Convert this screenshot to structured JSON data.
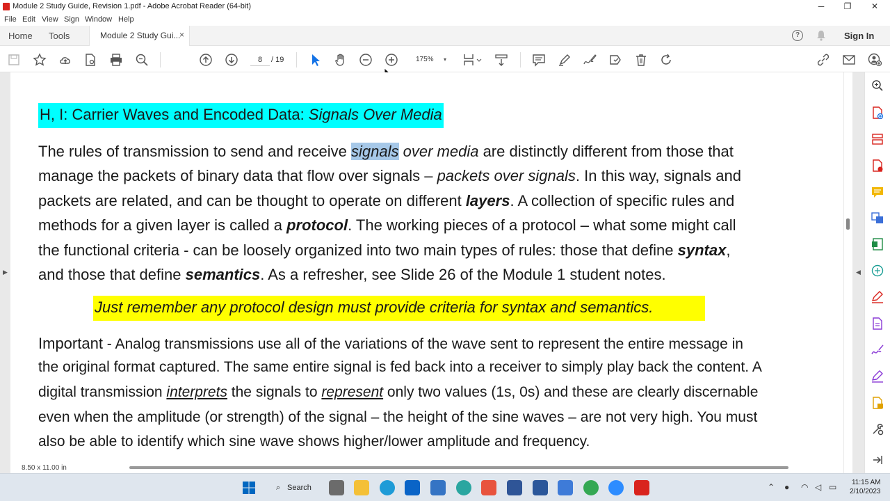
{
  "window": {
    "title": "Module 2 Study Guide, Revision 1.pdf - Adobe Acrobat Reader (64-bit)",
    "controls": [
      "─",
      "❐",
      "✕"
    ]
  },
  "menu": [
    "File",
    "Edit",
    "View",
    "Sign",
    "Window",
    "Help"
  ],
  "tabs": {
    "home": "Home",
    "tools": "Tools",
    "document": "Module 2 Study Gui...",
    "close": "×",
    "signin": "Sign In",
    "help": "?"
  },
  "toolbar": {
    "page_current": "8",
    "page_total": "/ 19",
    "zoom": "175%",
    "zoom_caret": "▾"
  },
  "icons": {
    "toolbar_left": [
      "save-icon",
      "bookmark-star-icon",
      "upload-cloud-icon",
      "file-search-icon",
      "print-icon",
      "search-zoom-icon"
    ],
    "toolbar_nav": [
      "page-up-icon",
      "page-down-icon"
    ],
    "toolbar_tools": [
      "select-pointer-icon",
      "hand-pan-icon",
      "zoom-out-icon",
      "zoom-in-icon"
    ],
    "toolbar_right": [
      "comment-icon",
      "highlight-pen-icon",
      "sign-icon",
      "stamp-icon",
      "trash-icon",
      "rotate-icon"
    ],
    "right_pane": [
      "search-icon",
      "create-pdf-icon",
      "organize-pages-icon",
      "export-pdf-icon",
      "comment-icon",
      "edit-pdf-icon",
      "export-excel-icon",
      "scan-icon",
      "fill-sign-icon",
      "protect-icon",
      "request-signature-icon",
      "prepare-form-icon",
      "more-tools-icon",
      "expand-pane-icon"
    ]
  },
  "document": {
    "heading_plain": "H, I: Carrier Waves and Encoded Data: ",
    "heading_italic": "Signals Over Media",
    "p1_l1_a": "The rules of transmission to send and receive ",
    "p1_l1_sel": "signals",
    "p1_l1_b": " over media",
    "p1_l1_c": " are distinctly different from those that",
    "p1_l2_a": "manage the packets of binary data that flow over signals – ",
    "p1_l2_b": "packets over signals",
    "p1_l2_c": ".  In this way, signals and",
    "p1_l3_a": "packets are related, and can be thought to operate on different ",
    "p1_l3_b": "layers",
    "p1_l3_c": ".  A collection of specific rules and",
    "p1_l4_a": "methods for a given layer is called a ",
    "p1_l4_b": "protocol",
    "p1_l4_c": ".  The working pieces of a protocol – what some might call",
    "p1_l5_a": "the functional criteria - can be loosely organized into two main types of rules: those that define ",
    "p1_l5_b": "syntax",
    "p1_l5_c": ",",
    "p1_l6_a": "and those that define ",
    "p1_l6_b": "semantics",
    "p1_l6_c": ".  As a refresher, see Slide 26 of the Module 1 student notes.",
    "callout": "Just remember any protocol design must provide criteria for syntax and semantics.",
    "p2_l1_a": "Important",
    "p2_l1_b": " - Analog transmissions use all of the variations of the wave sent to represent the entire message in",
    "p2_l2": "the original format captured.  The same entire signal is fed back into a receiver to simply play back the content.  A",
    "p2_l3_a": "digital transmission ",
    "p2_l3_b": "interprets",
    "p2_l3_c": " the signals to ",
    "p2_l3_d": "represent",
    "p2_l3_e": " only two values (1s, 0s) and these are clearly discernable",
    "p2_l4": "even when the amplitude (or strength) of the signal – the height of the sine waves – are not very high.  You must",
    "p2_l5": "also be able to identify which sine wave shows higher/lower amplitude and frequency."
  },
  "status": {
    "page_size": "8.50 x 11.00 in"
  },
  "taskbar": {
    "search": "Search",
    "time": "11:15 AM",
    "date": "2/10/2023",
    "apps": [
      "start-icon",
      "file-explorer-icon",
      "edge-icon",
      "outlook-icon",
      "app-s-icon",
      "app-teal-icon",
      "app-s-red-icon",
      "powershell-icon",
      "word-icon",
      "notepad-icon",
      "chrome-icon",
      "zoom-icon",
      "acrobat-icon"
    ],
    "colors": {
      "accent": "#0067c0",
      "edge": "#1e9bd7",
      "outlook": "#0a64c7",
      "word": "#2b579a",
      "acrobat": "#d9231d",
      "chrome": "#34a853",
      "zoom": "#2d8cff"
    }
  },
  "colors": {
    "heading_highlight": "#00ffff",
    "callout_highlight": "#ffff00",
    "selection": "#a6c8e8"
  }
}
